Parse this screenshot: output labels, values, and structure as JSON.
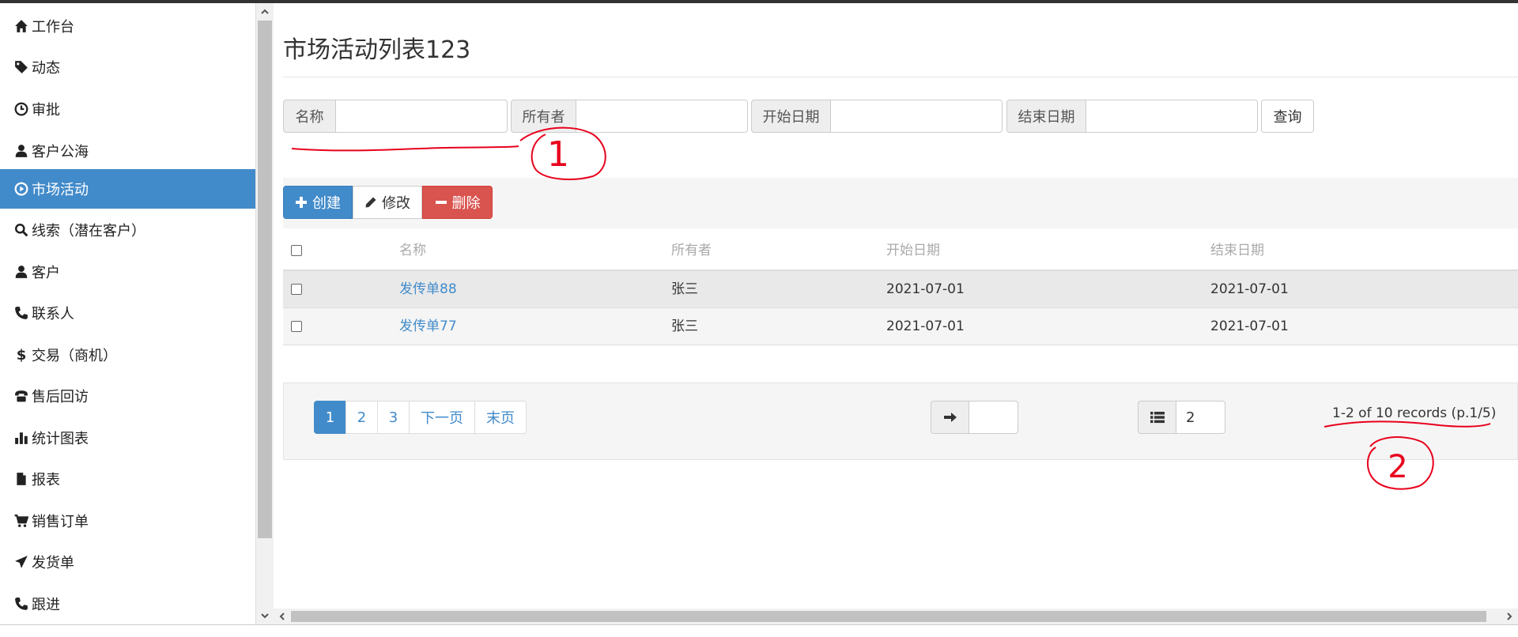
{
  "sidebar": {
    "items": [
      {
        "label": "工作台",
        "icon": "home-icon",
        "active": false
      },
      {
        "label": "动态",
        "icon": "tag-icon",
        "active": false
      },
      {
        "label": "审批",
        "icon": "clock-icon",
        "active": false
      },
      {
        "label": "客户公海",
        "icon": "user-icon",
        "active": false
      },
      {
        "label": "市场活动",
        "icon": "play-circle-icon",
        "active": true
      },
      {
        "label": "线索（潜在客户）",
        "icon": "search-icon",
        "active": false
      },
      {
        "label": "客户",
        "icon": "user-icon",
        "active": false
      },
      {
        "label": "联系人",
        "icon": "phone-icon",
        "active": false
      },
      {
        "label": "交易（商机）",
        "icon": "dollar-icon",
        "active": false
      },
      {
        "label": "售后回访",
        "icon": "phone-alt-icon",
        "active": false
      },
      {
        "label": "统计图表",
        "icon": "bar-chart-icon",
        "active": false
      },
      {
        "label": "报表",
        "icon": "file-icon",
        "active": false
      },
      {
        "label": "销售订单",
        "icon": "shopping-cart-icon",
        "active": false
      },
      {
        "label": "发货单",
        "icon": "send-icon",
        "active": false
      },
      {
        "label": "跟进",
        "icon": "phone-icon",
        "active": false
      }
    ]
  },
  "page": {
    "title": "市场活动列表123"
  },
  "search": {
    "name_label": "名称",
    "name_value": "",
    "owner_label": "所有者",
    "owner_value": "",
    "start_label": "开始日期",
    "start_value": "",
    "end_label": "结束日期",
    "end_value": "",
    "query_label": "查询"
  },
  "toolbar": {
    "create_label": "创建",
    "edit_label": "修改",
    "delete_label": "删除"
  },
  "table": {
    "headers": [
      "名称",
      "所有者",
      "开始日期",
      "结束日期"
    ],
    "rows": [
      {
        "name": "发传单88",
        "owner": "张三",
        "start": "2021-07-01",
        "end": "2021-07-01"
      },
      {
        "name": "发传单77",
        "owner": "张三",
        "start": "2021-07-01",
        "end": "2021-07-01"
      }
    ]
  },
  "pagination": {
    "pages": [
      "1",
      "2",
      "3",
      "下一页",
      "末页"
    ],
    "current": "1",
    "jump_value": "",
    "page_size": "2",
    "records_text": "1-2 of 10 records (p.1/5)"
  },
  "annotations": {
    "mark1": "1",
    "mark2": "2"
  },
  "colors": {
    "primary": "#428bca",
    "danger": "#d9534f",
    "annotation": "#e8001c"
  }
}
